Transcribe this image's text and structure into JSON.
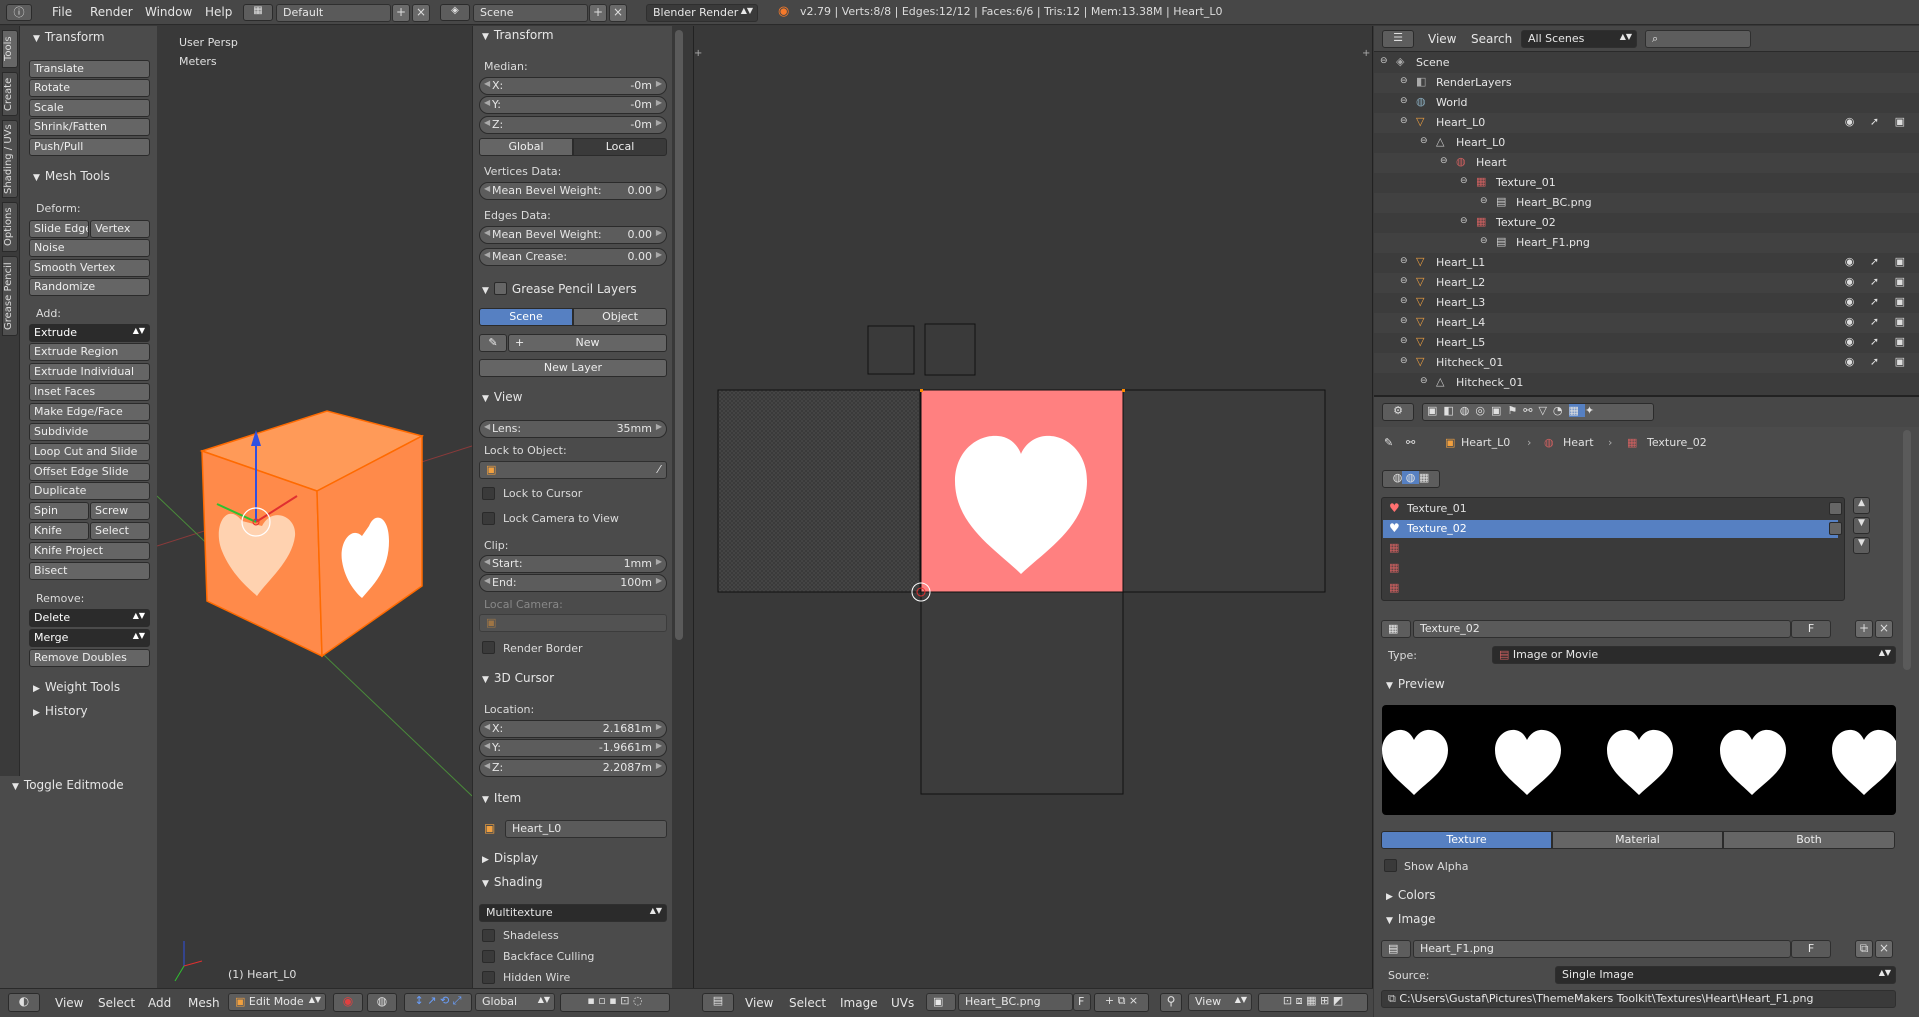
{
  "top": {
    "menus": [
      "File",
      "Render",
      "Window",
      "Help"
    ],
    "layout": "Default",
    "scene": "Scene",
    "engine": "Blender Render",
    "status": "v2.79 | Verts:8/8 | Edges:12/12 | Faces:6/6 | Tris:12 | Mem:13.38M | Heart_L0"
  },
  "tabs": [
    "Tools",
    "Create",
    "Shading / UVs",
    "Options",
    "Grease Pencil"
  ],
  "tool_shelf": {
    "transform_title": "Transform",
    "transform": [
      "Translate",
      "Rotate",
      "Scale",
      "Shrink/Fatten",
      "Push/Pull"
    ],
    "mesh_tools_title": "Mesh Tools",
    "deform_label": "Deform:",
    "slide_edge": "Slide Edge",
    "vertex": "Vertex",
    "deform": [
      "Noise",
      "Smooth Vertex",
      "Randomize"
    ],
    "add_label": "Add:",
    "extrude": "Extrude",
    "add": [
      "Extrude Region",
      "Extrude Individual",
      "Inset Faces",
      "Make Edge/Face",
      "Subdivide",
      "Loop Cut and Slide",
      "Offset Edge Slide",
      "Duplicate"
    ],
    "spin": "Spin",
    "screw": "Screw",
    "knife": "Knife",
    "select": "Select",
    "knife_project": "Knife Project",
    "bisect": "Bisect",
    "remove_label": "Remove:",
    "delete": "Delete",
    "merge": "Merge",
    "remove_doubles": "Remove Doubles",
    "weight_tools": "Weight Tools",
    "history": "History",
    "toggle_editmode": "Toggle Editmode"
  },
  "viewport": {
    "persp": "User Persp",
    "units": "Meters",
    "object": "(1) Heart_L0"
  },
  "npanel": {
    "transform": "Transform",
    "median": "Median:",
    "x": "X:",
    "xv": "-0m",
    "y": "Y:",
    "yv": "-0m",
    "z": "Z:",
    "zv": "-0m",
    "global": "Global",
    "local": "Local",
    "vertices_data": "Vertices Data:",
    "mean_bevel": "Mean Bevel Weight:",
    "mean_bevel_v": "0.00",
    "edges_data": "Edges Data:",
    "mean_bevel2": "Mean Bevel Weight:",
    "mean_bevel2_v": "0.00",
    "mean_crease": "Mean Crease:",
    "mean_crease_v": "0.00",
    "grease_pencil": "Grease Pencil Layers",
    "scene_btn": "Scene",
    "object_btn": "Object",
    "new": "New",
    "new_layer": "New Layer",
    "view": "View",
    "lens": "Lens:",
    "lens_v": "35mm",
    "lock_to_object": "Lock to Object:",
    "lock_to_cursor": "Lock to Cursor",
    "lock_camera": "Lock Camera to View",
    "clip": "Clip:",
    "start": "Start:",
    "start_v": "1mm",
    "end": "End:",
    "end_v": "100m",
    "local_camera": "Local Camera:",
    "render_border": "Render Border",
    "cursor3d": "3D Cursor",
    "location": "Location:",
    "cx": "X:",
    "cxv": "2.1681m",
    "cy": "Y:",
    "cyv": "-1.9661m",
    "cz": "Z:",
    "czv": "2.2087m",
    "item": "Item",
    "item_name": "Heart_L0",
    "display": "Display",
    "shading": "Shading",
    "multitexture": "Multitexture",
    "shadeless": "Shadeless",
    "backface": "Backface Culling",
    "hidden_wire": "Hidden Wire"
  },
  "bottom_3d": {
    "menus": [
      "View",
      "Select",
      "Add",
      "Mesh"
    ],
    "mode": "Edit Mode",
    "orientation": "Global"
  },
  "bottom_uv": {
    "menus": [
      "View",
      "Select",
      "Image",
      "UVs"
    ],
    "image": "Heart_BC.png",
    "f": "F",
    "view": "View"
  },
  "outliner": {
    "view": "View",
    "search": "Search",
    "scenes": "All Scenes",
    "rows": [
      {
        "label": "Scene",
        "indent": 0
      },
      {
        "label": "RenderLayers",
        "indent": 1
      },
      {
        "label": "World",
        "indent": 1
      },
      {
        "label": "Heart_L0",
        "indent": 1,
        "vis": true
      },
      {
        "label": "Heart_L0",
        "indent": 2
      },
      {
        "label": "Heart",
        "indent": 3
      },
      {
        "label": "Texture_01",
        "indent": 4
      },
      {
        "label": "Heart_BC.png",
        "indent": 5
      },
      {
        "label": "Texture_02",
        "indent": 4
      },
      {
        "label": "Heart_F1.png",
        "indent": 5
      },
      {
        "label": "Heart_L1",
        "indent": 1,
        "vis": true
      },
      {
        "label": "Heart_L2",
        "indent": 1,
        "vis": true
      },
      {
        "label": "Heart_L3",
        "indent": 1,
        "vis": true
      },
      {
        "label": "Heart_L4",
        "indent": 1,
        "vis": true
      },
      {
        "label": "Heart_L5",
        "indent": 1,
        "vis": true
      },
      {
        "label": "Hitcheck_01",
        "indent": 1,
        "vis": true
      },
      {
        "label": "Hitcheck_01",
        "indent": 2
      }
    ]
  },
  "properties": {
    "crumb1": "Heart_L0",
    "crumb2": "Heart",
    "crumb3": "Texture_02",
    "slots": [
      "Texture_01",
      "Texture_02"
    ],
    "texture_name": "Texture_02",
    "f": "F",
    "type_label": "Type:",
    "type_value": "Image or Movie",
    "preview": "Preview",
    "tex_btn": "Texture",
    "mat_btn": "Material",
    "both_btn": "Both",
    "show_alpha": "Show Alpha",
    "colors": "Colors",
    "image": "Image",
    "image_name": "Heart_F1.png",
    "source_label": "Source:",
    "source_value": "Single Image",
    "path": "C:\\Users\\Gustaf\\Pictures\\ThemeMakers Toolkit\\Textures\\Heart\\Heart_F1.png"
  },
  "colors": {
    "accent": "#5680c2",
    "cube": "#ff8a4a",
    "uv_face": "#ff8080"
  }
}
